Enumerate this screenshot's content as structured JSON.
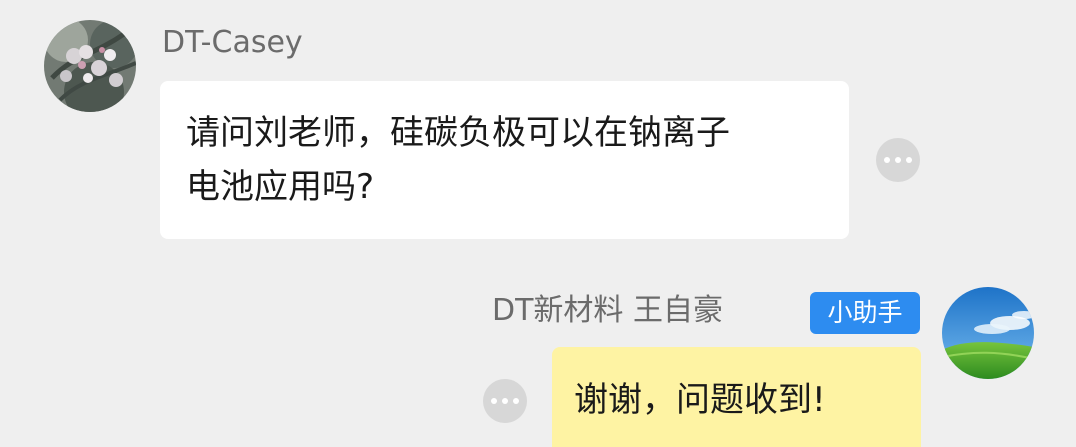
{
  "messages": [
    {
      "sender": "DT-Casey",
      "avatar_icon": "cherry-blossom-avatar-icon",
      "text_lines": [
        "请问刘老师，硅碳负极可以在钠离子",
        "电池应用吗?"
      ],
      "more_icon": "more-options-icon"
    },
    {
      "sender": "DT新材料 王自豪",
      "badge": "小助手",
      "avatar_icon": "landscape-avatar-icon",
      "text": "谢谢，问题收到!",
      "more_icon": "more-options-icon"
    }
  ],
  "colors": {
    "background": "#efefef",
    "incoming_bubble": "#ffffff",
    "outgoing_bubble": "#fef3a3",
    "badge": "#2d8cf0",
    "sender_name": "#6b6b6b"
  }
}
